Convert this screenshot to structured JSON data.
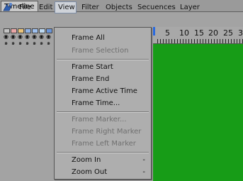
{
  "window": {
    "tab_label": "Timeline"
  },
  "menubar": {
    "app_icon": "timeline-app-icon",
    "items": [
      {
        "label": "File"
      },
      {
        "label": "Edit"
      },
      {
        "label": "View"
      },
      {
        "label": "Filter"
      },
      {
        "label": "Objects"
      },
      {
        "label": "Secuences"
      },
      {
        "label": "Layer"
      }
    ]
  },
  "tracks": {
    "swatch_colors": [
      "#c2c2c2",
      "#e9a6a6",
      "#eac37a",
      "#8fb2e6",
      "#9ec0ee",
      "#bcd8f0",
      "#6b95d8"
    ],
    "eye_icon": "eye-icon",
    "lock_icon": "lock-icon"
  },
  "ruler": {
    "labels": [
      "5",
      "10",
      "15",
      "20",
      "25",
      "3"
    ]
  },
  "colors": {
    "timeline_bg": "#179c17",
    "marker": "#2a6adf",
    "menu_active": "#cfd3d9"
  },
  "view_menu": {
    "items": [
      {
        "label": "Frame All",
        "enabled": true
      },
      {
        "label": "Frame Selection",
        "enabled": false
      },
      {
        "label": "Frame Start",
        "enabled": true
      },
      {
        "label": "Frame End",
        "enabled": true
      },
      {
        "label": "Frame Active Time",
        "enabled": true
      },
      {
        "label": "Frame Time...",
        "enabled": true
      },
      {
        "label": "Frame Marker...",
        "enabled": false
      },
      {
        "label": "Frame Right Marker",
        "enabled": false
      },
      {
        "label": "Frame Left Marker",
        "enabled": false
      },
      {
        "label": "Zoom In",
        "enabled": true,
        "shortcut": "-"
      },
      {
        "label": "Zoom Out",
        "enabled": true,
        "shortcut": "-"
      }
    ]
  }
}
